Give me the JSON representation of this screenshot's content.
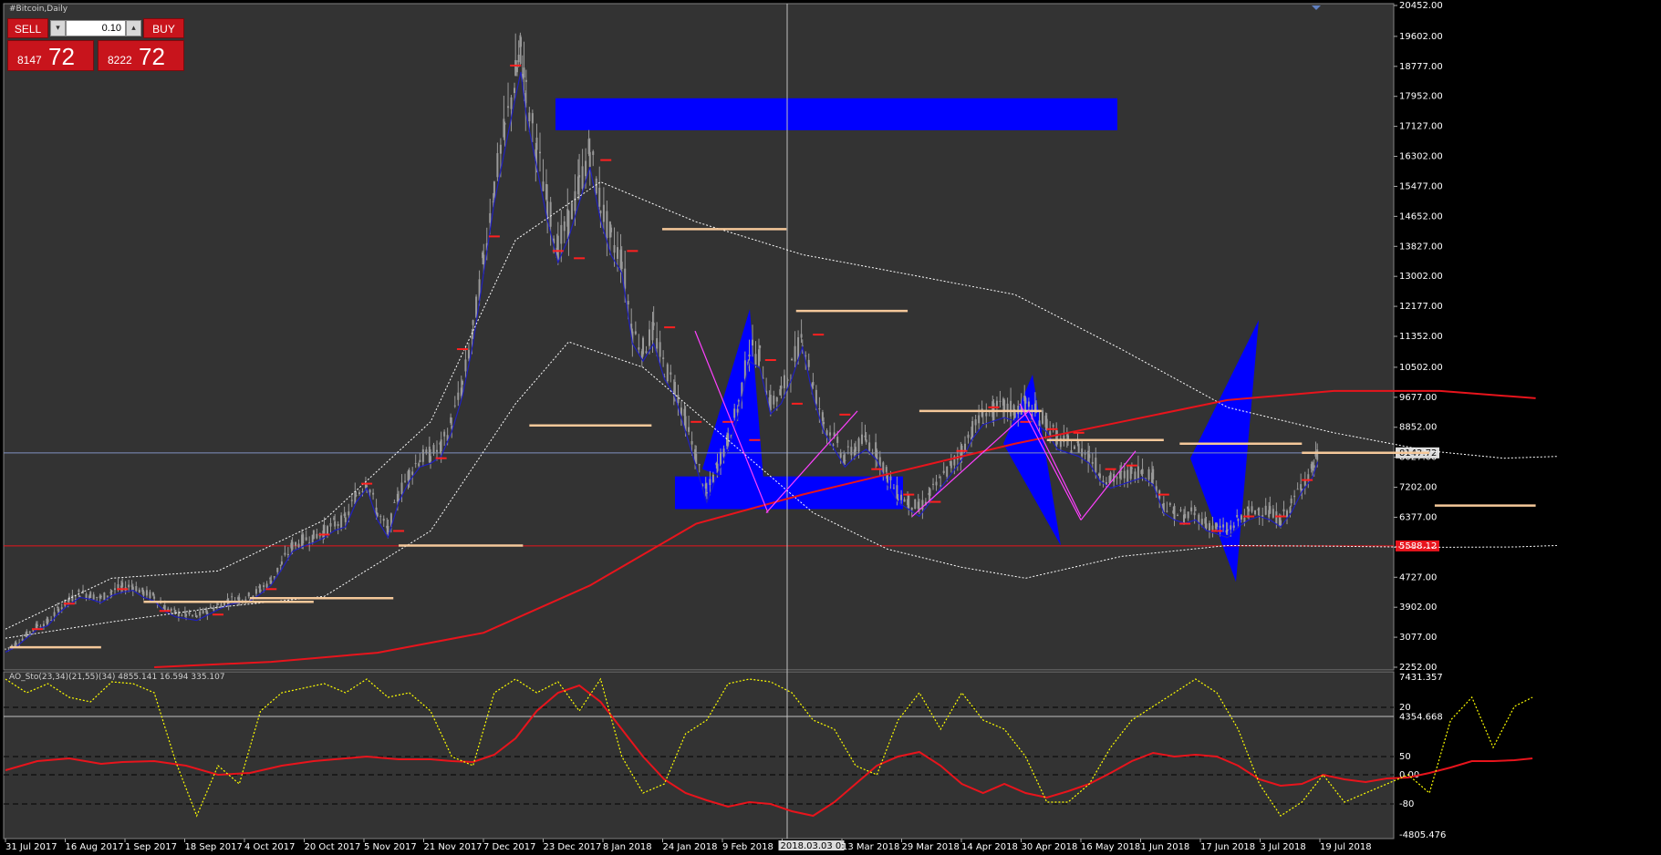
{
  "window": {
    "title": "#Bitcoin,Daily"
  },
  "trade_panel": {
    "sell_label": "SELL",
    "buy_label": "BUY",
    "lot": "0.10",
    "sell_price_small": "8147",
    "sell_price_big": "72",
    "buy_price_small": "8222",
    "buy_price_big": "72",
    "spin_down": "▾",
    "spin_up": "▴"
  },
  "colors": {
    "background": "#000000",
    "plot_bg": "#333333",
    "grid": "#606060",
    "candle": "#9a9a9a",
    "red_line": "#e8141c",
    "blue_zone": "#0000ff",
    "orange_level": "#f5c89a",
    "fractal_red": "#ff2020",
    "ma_blue": "#2020c0",
    "magenta": "#ff40ff",
    "yellow_osc": "#ffff00",
    "axis_text": "#ffffff"
  },
  "main_axis": {
    "price_min": 2252,
    "price_max": 20452,
    "labels": [
      "20452.00",
      "19602.00",
      "18777.00",
      "17952.00",
      "17127.00",
      "16302.00",
      "15477.00",
      "14652.00",
      "13827.00",
      "13002.00",
      "12177.00",
      "11352.00",
      "10502.00",
      "9677.00",
      "8852.00",
      "8027.00",
      "7202.00",
      "6377.00",
      "5552.00",
      "4727.00",
      "3902.00",
      "3077.00",
      "2252.00"
    ],
    "current_price_tag": "8147.72",
    "support_tag": "5588.12"
  },
  "date_axis": {
    "labels": [
      "31 Jul 2017",
      "16 Aug 2017",
      "1 Sep 2017",
      "18 Sep 2017",
      "4 Oct 2017",
      "20 Oct 2017",
      "5 Nov 2017",
      "21 Nov 2017",
      "7 Dec 2017",
      "23 Dec 2017",
      "8 Jan 2018",
      "24 Jan 2018",
      "9 Feb 2018",
      "2018.03.03 0:00",
      "13 Mar 2018",
      "29 Mar 2018",
      "14 Apr 2018",
      "30 Apr 2018",
      "16 May 2018",
      "1 Jun 2018",
      "17 Jun 2018",
      "3 Jul 2018",
      "19 Jul 2018"
    ]
  },
  "indicator": {
    "label": "AO_Sto(23,34)(21,55)(34) 4855.141 16.594 335.107",
    "axis_labels": [
      "7431.357",
      "4354.668",
      "-4805.476"
    ],
    "osc_levels": [
      "20",
      "50",
      "0.00",
      "-80"
    ]
  },
  "chart_data": {
    "type": "candlestick",
    "symbol": "#Bitcoin",
    "timeframe": "Daily",
    "x_range": [
      "31 Jul 2017",
      "19 Jul 2018"
    ],
    "ylim": [
      2252,
      20452
    ],
    "close_path": [
      [
        0,
        2750
      ],
      [
        10,
        2900
      ],
      [
        20,
        3150
      ],
      [
        30,
        3400
      ],
      [
        40,
        3500
      ],
      [
        50,
        3850
      ],
      [
        60,
        4100
      ],
      [
        70,
        4300
      ],
      [
        80,
        4250
      ],
      [
        90,
        4150
      ],
      [
        100,
        4350
      ],
      [
        110,
        4450
      ],
      [
        120,
        4500
      ],
      [
        130,
        4300
      ],
      [
        140,
        4200
      ],
      [
        150,
        3900
      ],
      [
        160,
        3750
      ],
      [
        170,
        3700
      ],
      [
        180,
        3650
      ],
      [
        190,
        3800
      ],
      [
        200,
        3950
      ],
      [
        210,
        4100
      ],
      [
        220,
        4150
      ],
      [
        230,
        4200
      ],
      [
        240,
        4400
      ],
      [
        250,
        4650
      ],
      [
        260,
        5100
      ],
      [
        270,
        5600
      ],
      [
        280,
        5750
      ],
      [
        290,
        5850
      ],
      [
        300,
        6000
      ],
      [
        310,
        6200
      ],
      [
        320,
        6300
      ],
      [
        330,
        7000
      ],
      [
        340,
        7400
      ],
      [
        350,
        6500
      ],
      [
        360,
        6000
      ],
      [
        370,
        7000
      ],
      [
        380,
        7600
      ],
      [
        390,
        8000
      ],
      [
        400,
        8100
      ],
      [
        410,
        8300
      ],
      [
        420,
        9000
      ],
      [
        430,
        10000
      ],
      [
        440,
        11500
      ],
      [
        450,
        13500
      ],
      [
        460,
        15500
      ],
      [
        470,
        17000
      ],
      [
        480,
        18500
      ],
      [
        485,
        19200
      ],
      [
        490,
        18000
      ],
      [
        500,
        16500
      ],
      [
        510,
        15000
      ],
      [
        520,
        13800
      ],
      [
        530,
        14500
      ],
      [
        540,
        15500
      ],
      [
        550,
        16500
      ],
      [
        560,
        15000
      ],
      [
        570,
        14000
      ],
      [
        580,
        13500
      ],
      [
        590,
        11500
      ],
      [
        600,
        11000
      ],
      [
        610,
        11500
      ],
      [
        620,
        10500
      ],
      [
        630,
        10000
      ],
      [
        640,
        9000
      ],
      [
        650,
        8000
      ],
      [
        660,
        7000
      ],
      [
        670,
        7800
      ],
      [
        680,
        8500
      ],
      [
        690,
        9500
      ],
      [
        700,
        11000
      ],
      [
        710,
        10800
      ],
      [
        720,
        9500
      ],
      [
        730,
        9800
      ],
      [
        740,
        10500
      ],
      [
        750,
        11400
      ],
      [
        760,
        10000
      ],
      [
        770,
        9000
      ],
      [
        780,
        8500
      ],
      [
        790,
        8000
      ],
      [
        800,
        8300
      ],
      [
        810,
        8500
      ],
      [
        820,
        8200
      ],
      [
        830,
        7500
      ],
      [
        840,
        7000
      ],
      [
        850,
        6800
      ],
      [
        860,
        6600
      ],
      [
        870,
        7000
      ],
      [
        880,
        7400
      ],
      [
        890,
        7800
      ],
      [
        900,
        8200
      ],
      [
        910,
        8800
      ],
      [
        920,
        9200
      ],
      [
        930,
        9300
      ],
      [
        940,
        9400
      ],
      [
        950,
        9300
      ],
      [
        960,
        9500
      ],
      [
        970,
        9200
      ],
      [
        980,
        9000
      ],
      [
        990,
        8500
      ],
      [
        1000,
        8400
      ],
      [
        1010,
        8300
      ],
      [
        1020,
        8100
      ],
      [
        1030,
        7600
      ],
      [
        1040,
        7400
      ],
      [
        1050,
        7500
      ],
      [
        1060,
        7600
      ],
      [
        1070,
        7700
      ],
      [
        1080,
        7500
      ],
      [
        1090,
        6700
      ],
      [
        1100,
        6500
      ],
      [
        1110,
        6400
      ],
      [
        1120,
        6500
      ],
      [
        1130,
        6200
      ],
      [
        1140,
        6100
      ],
      [
        1150,
        6000
      ],
      [
        1160,
        6300
      ],
      [
        1170,
        6500
      ],
      [
        1180,
        6600
      ],
      [
        1190,
        6500
      ],
      [
        1200,
        6300
      ],
      [
        1210,
        6700
      ],
      [
        1220,
        7300
      ],
      [
        1230,
        7700
      ],
      [
        1235,
        8147.72
      ]
    ],
    "annotations": {
      "supply_zone": [
        17020,
        17900
      ],
      "demand_zone": [
        6600,
        7500
      ],
      "support_line": 5588.12,
      "current_price": 8147.72
    },
    "indicator": {
      "name": "AO_Sto(23,34)(21,55)(34)",
      "values": [
        4855.141,
        16.594,
        335.107
      ],
      "levels": [
        20,
        50,
        0,
        -80
      ]
    }
  }
}
